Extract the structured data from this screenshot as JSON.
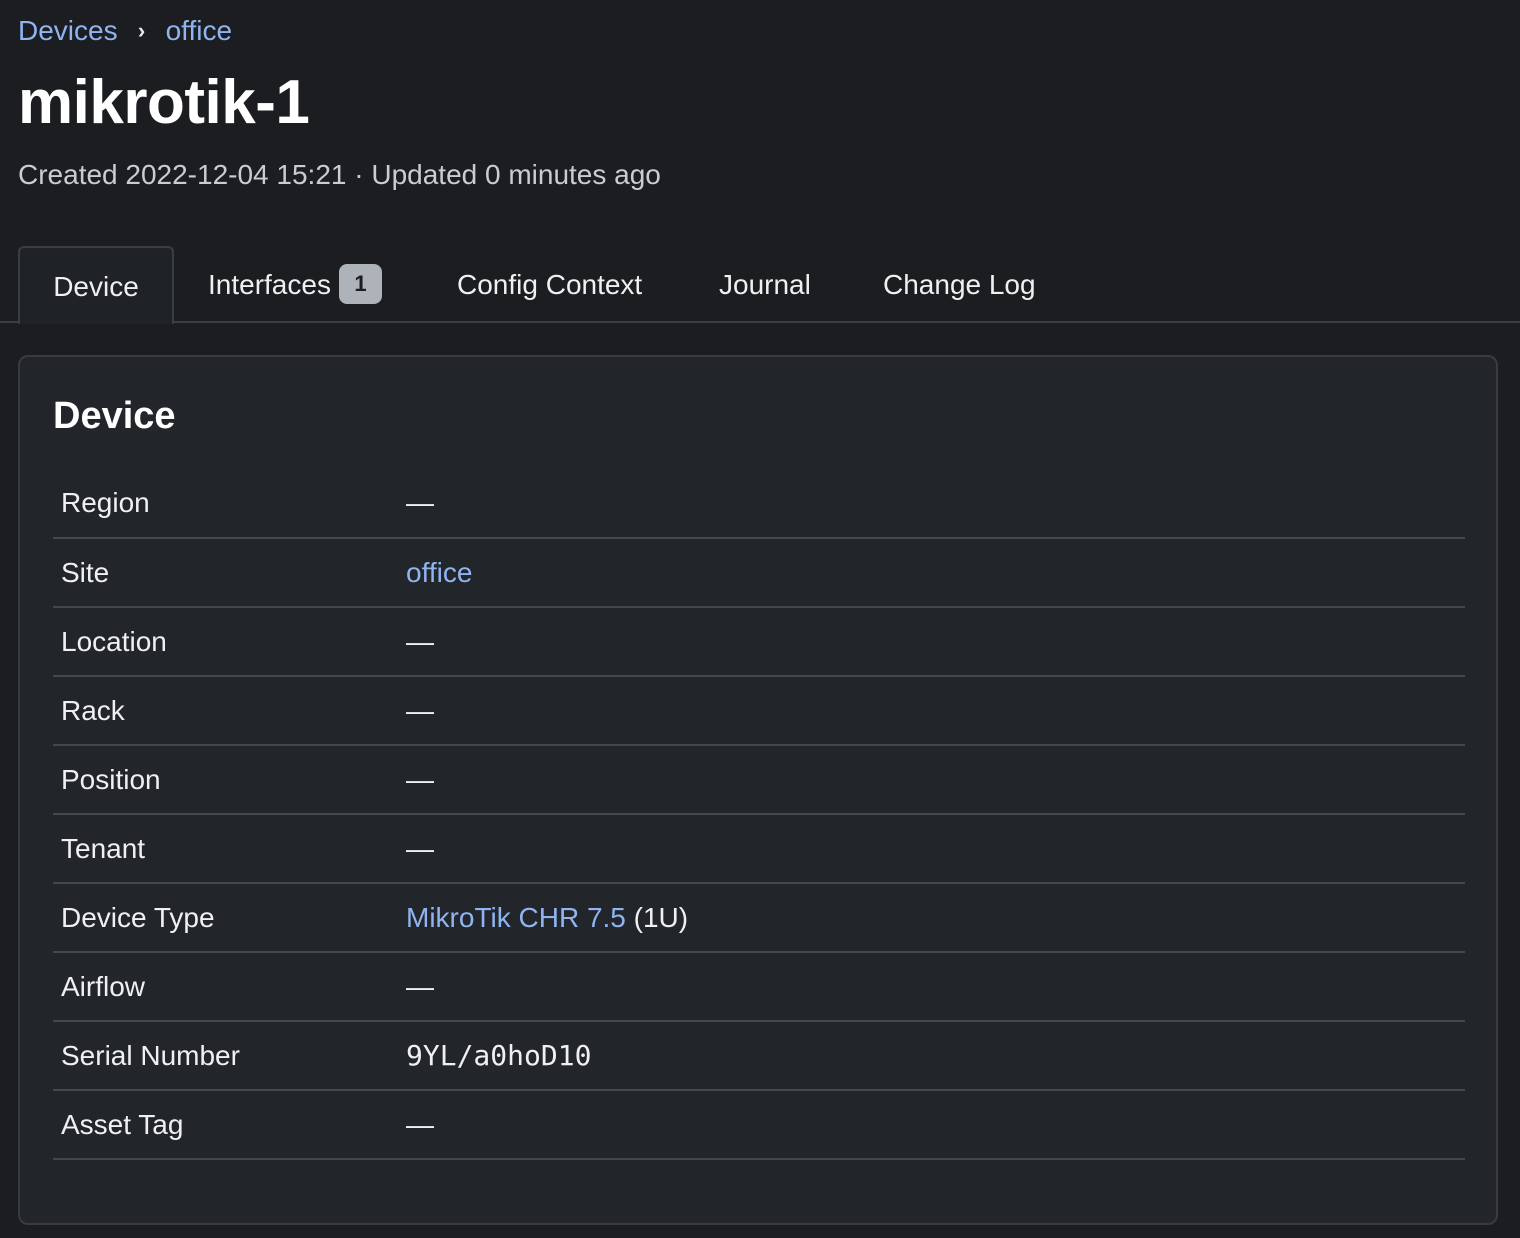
{
  "breadcrumb": {
    "items": [
      {
        "label": "Devices"
      },
      {
        "label": "office"
      }
    ],
    "separator": "›"
  },
  "page": {
    "title": "mikrotik-1",
    "meta": "Created 2022-12-04 15:21 · Updated 0 minutes ago"
  },
  "tabs": [
    {
      "label": "Device",
      "active": true
    },
    {
      "label": "Interfaces",
      "badge": "1"
    },
    {
      "label": "Config Context"
    },
    {
      "label": "Journal"
    },
    {
      "label": "Change Log"
    }
  ],
  "card": {
    "title": "Device",
    "rows": [
      {
        "label": "Region",
        "value": "—"
      },
      {
        "label": "Site",
        "value": "office",
        "link": true
      },
      {
        "label": "Location",
        "value": "—"
      },
      {
        "label": "Rack",
        "value": "—"
      },
      {
        "label": "Position",
        "value": "—"
      },
      {
        "label": "Tenant",
        "value": "—"
      },
      {
        "label": "Device Type",
        "value": "MikroTik CHR 7.5",
        "suffix": "(1U)",
        "link": true
      },
      {
        "label": "Airflow",
        "value": "—"
      },
      {
        "label": "Serial Number",
        "value": "9YL/a0hoD10",
        "mono": true
      },
      {
        "label": "Asset Tag",
        "value": "—"
      }
    ]
  },
  "colors": {
    "background": "#1b1d21",
    "card": "#22252a",
    "link": "#8fb4f0",
    "text": "#e6e8eb"
  }
}
